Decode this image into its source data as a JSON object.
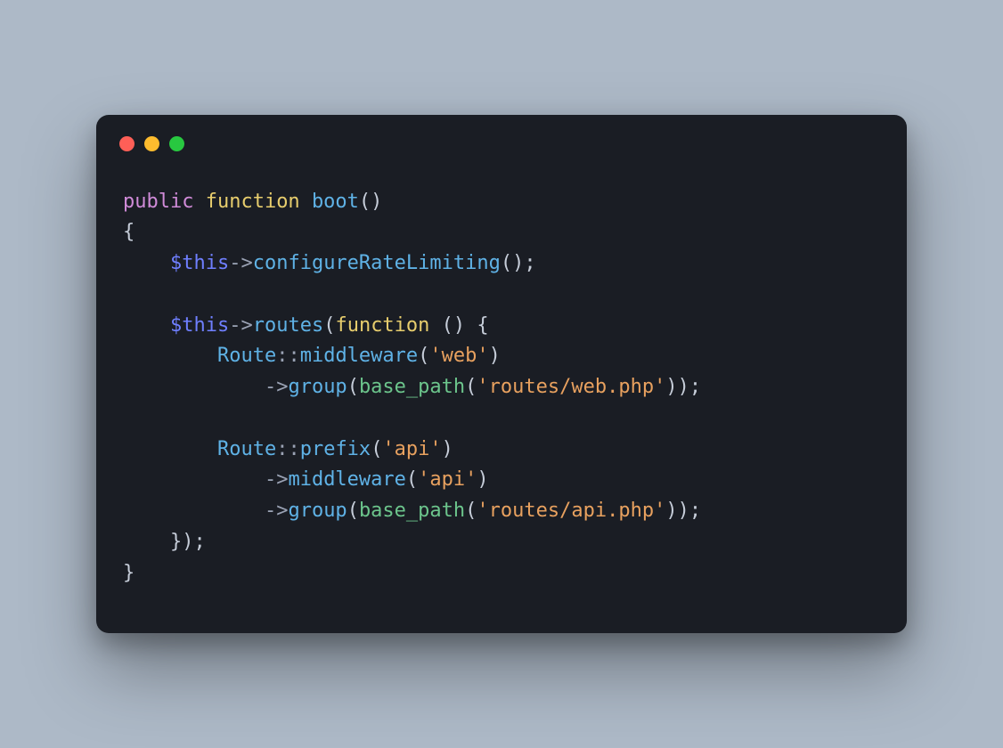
{
  "colors": {
    "bg": "#adb9c7",
    "card": "#1a1d24",
    "traffic": {
      "red": "#ff5f57",
      "yellow": "#febc2e",
      "green": "#28c840"
    },
    "tokens": {
      "keyword_purple": "#d08bd8",
      "keyword_yellow": "#e7cd6d",
      "identifier_blue": "#5fb2e6",
      "variable_indigo": "#6f7fff",
      "default_text": "#c6cdd9",
      "operator_grey": "#9aa2b4",
      "builtin_green": "#6cc58c",
      "string_orange": "#e8a15f"
    }
  },
  "code": [
    [
      {
        "t": "public ",
        "c": "kw"
      },
      {
        "t": "function ",
        "c": "kw2"
      },
      {
        "t": "boot",
        "c": "fnname"
      },
      {
        "t": "()",
        "c": "punc"
      }
    ],
    [
      {
        "t": "{",
        "c": "punc"
      }
    ],
    [
      {
        "t": "    ",
        "c": "punc"
      },
      {
        "t": "$this",
        "c": "var"
      },
      {
        "t": "->",
        "c": "op"
      },
      {
        "t": "configureRateLimiting",
        "c": "call"
      },
      {
        "t": "();",
        "c": "punc"
      }
    ],
    [
      {
        "t": "",
        "c": "punc"
      }
    ],
    [
      {
        "t": "    ",
        "c": "punc"
      },
      {
        "t": "$this",
        "c": "var"
      },
      {
        "t": "->",
        "c": "op"
      },
      {
        "t": "routes",
        "c": "call"
      },
      {
        "t": "(",
        "c": "punc"
      },
      {
        "t": "function ",
        "c": "kw2"
      },
      {
        "t": "() {",
        "c": "punc"
      }
    ],
    [
      {
        "t": "        ",
        "c": "punc"
      },
      {
        "t": "Route",
        "c": "type"
      },
      {
        "t": "::",
        "c": "op"
      },
      {
        "t": "middleware",
        "c": "call"
      },
      {
        "t": "(",
        "c": "punc"
      },
      {
        "t": "'web'",
        "c": "str"
      },
      {
        "t": ")",
        "c": "punc"
      }
    ],
    [
      {
        "t": "            ",
        "c": "punc"
      },
      {
        "t": "->",
        "c": "op"
      },
      {
        "t": "group",
        "c": "call"
      },
      {
        "t": "(",
        "c": "punc"
      },
      {
        "t": "base_path",
        "c": "fn2"
      },
      {
        "t": "(",
        "c": "punc"
      },
      {
        "t": "'routes/web.php'",
        "c": "str"
      },
      {
        "t": "));",
        "c": "punc"
      }
    ],
    [
      {
        "t": "",
        "c": "punc"
      }
    ],
    [
      {
        "t": "        ",
        "c": "punc"
      },
      {
        "t": "Route",
        "c": "type"
      },
      {
        "t": "::",
        "c": "op"
      },
      {
        "t": "prefix",
        "c": "call"
      },
      {
        "t": "(",
        "c": "punc"
      },
      {
        "t": "'api'",
        "c": "str"
      },
      {
        "t": ")",
        "c": "punc"
      }
    ],
    [
      {
        "t": "            ",
        "c": "punc"
      },
      {
        "t": "->",
        "c": "op"
      },
      {
        "t": "middleware",
        "c": "call"
      },
      {
        "t": "(",
        "c": "punc"
      },
      {
        "t": "'api'",
        "c": "str"
      },
      {
        "t": ")",
        "c": "punc"
      }
    ],
    [
      {
        "t": "            ",
        "c": "punc"
      },
      {
        "t": "->",
        "c": "op"
      },
      {
        "t": "group",
        "c": "call"
      },
      {
        "t": "(",
        "c": "punc"
      },
      {
        "t": "base_path",
        "c": "fn2"
      },
      {
        "t": "(",
        "c": "punc"
      },
      {
        "t": "'routes/api.php'",
        "c": "str"
      },
      {
        "t": "));",
        "c": "punc"
      }
    ],
    [
      {
        "t": "    });",
        "c": "punc"
      }
    ],
    [
      {
        "t": "}",
        "c": "punc"
      }
    ]
  ]
}
